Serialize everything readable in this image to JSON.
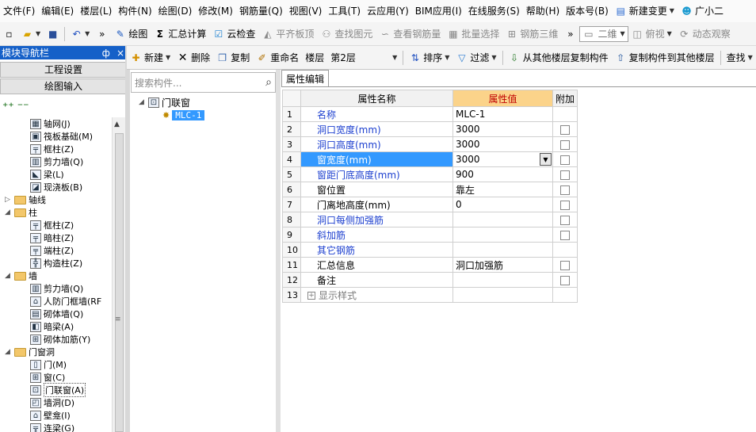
{
  "menu": [
    "文件(F)",
    "编辑(E)",
    "楼层(L)",
    "构件(N)",
    "绘图(D)",
    "修改(M)",
    "钢筋量(Q)",
    "视图(V)",
    "工具(T)",
    "云应用(Y)",
    "BIM应用(I)",
    "在线服务(S)",
    "帮助(H)",
    "版本号(B)"
  ],
  "menu_extra": {
    "new_change": "新建变更",
    "assistant": "广小二"
  },
  "toolbar1": {
    "draw": "绘图",
    "sum_calc": "汇总计算",
    "cloud_check": "云检查",
    "align_slab": "平齐板顶",
    "find_elem": "查找图元",
    "view_rebar": "查看钢筋量",
    "batch_select": "批量选择",
    "rebar_3d": "钢筋三维",
    "view_mode": "二维",
    "view_dir": "俯视",
    "dynamic_view": "动态观察"
  },
  "nav": {
    "title": "模块导航栏",
    "pin": "ф",
    "close": "×",
    "btn_project": "工程设置",
    "btn_draw": "绘图输入"
  },
  "toolbar2": {
    "new": "新建",
    "delete": "删除",
    "copy": "复制",
    "rename": "重命名",
    "floor_label": "楼层",
    "floor_value": "第2层",
    "sort": "排序",
    "filter": "过滤",
    "copy_from_floor": "从其他楼层复制构件",
    "copy_to_floor": "复制构件到其他楼层",
    "find": "查找"
  },
  "tree": [
    {
      "label": "轴网(J)",
      "icon": "grid-icon",
      "level": 2
    },
    {
      "label": "筏板基础(M)",
      "icon": "raft-foundation-icon",
      "level": 2
    },
    {
      "label": "框柱(Z)",
      "icon": "frame-column-icon",
      "level": 2
    },
    {
      "label": "剪力墙(Q)",
      "icon": "shear-wall-icon",
      "level": 2
    },
    {
      "label": "梁(L)",
      "icon": "beam-icon",
      "level": 2
    },
    {
      "label": "现浇板(B)",
      "icon": "slab-icon",
      "level": 2
    },
    {
      "label": "轴线",
      "folder": true,
      "expanded": false,
      "level": 1
    },
    {
      "label": "柱",
      "folder": true,
      "expanded": true,
      "level": 1
    },
    {
      "label": "框柱(Z)",
      "icon": "frame-column-icon",
      "level": 2
    },
    {
      "label": "暗柱(Z)",
      "icon": "hidden-column-icon",
      "level": 2
    },
    {
      "label": "端柱(Z)",
      "icon": "end-column-icon",
      "level": 2
    },
    {
      "label": "构造柱(Z)",
      "icon": "constructional-column-icon",
      "level": 2
    },
    {
      "label": "墙",
      "folder": true,
      "expanded": true,
      "level": 1
    },
    {
      "label": "剪力墙(Q)",
      "icon": "shear-wall-icon",
      "level": 2
    },
    {
      "label": "人防门框墙(RF",
      "icon": "civil-defense-wall-icon",
      "level": 2
    },
    {
      "label": "砌体墙(Q)",
      "icon": "masonry-wall-icon",
      "level": 2
    },
    {
      "label": "暗梁(A)",
      "icon": "hidden-beam-icon",
      "level": 2
    },
    {
      "label": "砌体加筋(Y)",
      "icon": "masonry-rebar-icon",
      "level": 2
    },
    {
      "label": "门窗洞",
      "folder": true,
      "expanded": true,
      "level": 1
    },
    {
      "label": "门(M)",
      "icon": "door-icon",
      "level": 2
    },
    {
      "label": "窗(C)",
      "icon": "window-icon",
      "level": 2
    },
    {
      "label": "门联窗(A)",
      "icon": "door-window-icon",
      "level": 2,
      "selected": true
    },
    {
      "label": "墙洞(D)",
      "icon": "wall-opening-icon",
      "level": 2
    },
    {
      "label": "壁龛(I)",
      "icon": "niche-icon",
      "level": 2
    },
    {
      "label": "连梁(G)",
      "icon": "coupling-beam-icon",
      "level": 2
    }
  ],
  "search": {
    "placeholder": "搜索构件..."
  },
  "component_tree": {
    "root": "门联窗",
    "child": "MLC-1"
  },
  "prop_tab": "属性编辑",
  "grid": {
    "headers": {
      "name": "属性名称",
      "value": "属性值",
      "add": "附加"
    },
    "rows": [
      {
        "idx": "1",
        "name": "名称",
        "value": "MLC-1",
        "blue": true,
        "check": false
      },
      {
        "idx": "2",
        "name": "洞口宽度(mm)",
        "value": "3000",
        "blue": true,
        "check": true
      },
      {
        "idx": "3",
        "name": "洞口高度(mm)",
        "value": "3000",
        "blue": true,
        "check": true
      },
      {
        "idx": "4",
        "name": "窗宽度(mm)",
        "value": "3000",
        "blue": true,
        "check": true,
        "selected": true
      },
      {
        "idx": "5",
        "name": "窗距门底高度(mm)",
        "value": "900",
        "blue": true,
        "check": true
      },
      {
        "idx": "6",
        "name": "窗位置",
        "value": "靠左",
        "blue": false,
        "check": true
      },
      {
        "idx": "7",
        "name": "门离地高度(mm)",
        "value": "0",
        "blue": false,
        "check": true
      },
      {
        "idx": "8",
        "name": "洞口每侧加强筋",
        "value": "",
        "blue": true,
        "check": true
      },
      {
        "idx": "9",
        "name": "斜加筋",
        "value": "",
        "blue": true,
        "check": true
      },
      {
        "idx": "10",
        "name": "其它钢筋",
        "value": "",
        "blue": true,
        "check": false
      },
      {
        "idx": "11",
        "name": "汇总信息",
        "value": "洞口加强筋",
        "blue": false,
        "check": true
      },
      {
        "idx": "12",
        "name": "备注",
        "value": "",
        "blue": false,
        "check": true
      },
      {
        "idx": "13",
        "name": "显示样式",
        "value": "",
        "blue": false,
        "check": false,
        "gray": true,
        "expander": true
      }
    ]
  }
}
